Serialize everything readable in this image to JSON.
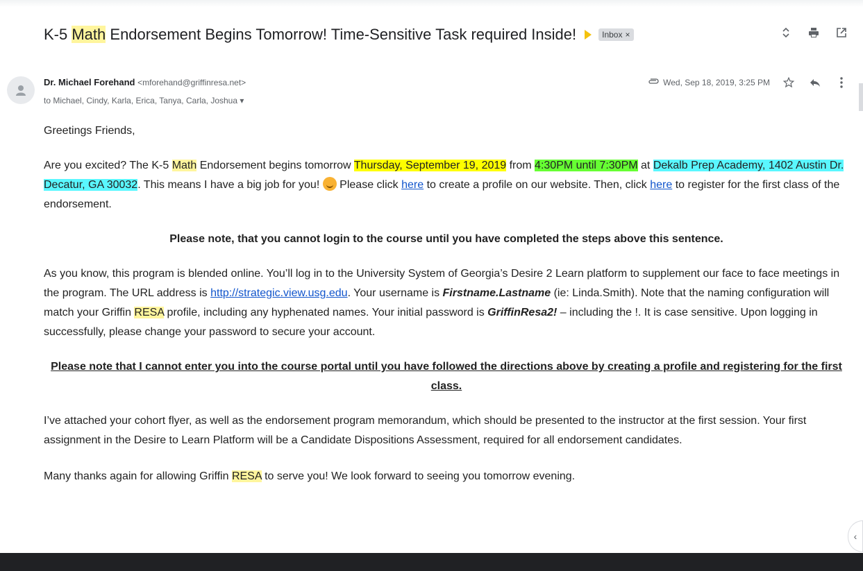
{
  "subject": {
    "pre": "K-5 ",
    "hl": "Math",
    "post": " Endorsement Begins Tomorrow! Time-Sensitive Task required Inside!",
    "label": "Inbox",
    "label_close": "×"
  },
  "sender": {
    "name": "Dr. Michael Forehand",
    "email": "<mforehand@griffinresa.net>",
    "to": "to Michael, Cindy, Karla, Erica, Tanya, Carla, Joshua",
    "date": "Wed, Sep 18, 2019, 3:25 PM"
  },
  "body": {
    "greeting": "Greetings Friends,",
    "p1_a": "Are you excited? The K-5 ",
    "p1_math": "Math",
    "p1_b": " Endorsement begins tomorrow ",
    "p1_date": "Thursday, September 19, 2019",
    "p1_c": " from ",
    "p1_time": "4:30PM until 7:30PM",
    "p1_d": " at ",
    "p1_loc": "Dekalb Prep Academy, 1402 Austin Dr. Decatur, GA 30032",
    "p1_e": ".  This means I have a big job for you! ",
    "p1_f": "  Please click ",
    "p1_link1": "here",
    "p1_g": " to create a profile on our website.  Then, click ",
    "p1_link2": "here",
    "p1_h": " to register for the first class of the endorsement.",
    "note1": "Please note, that you cannot login to the course until you have completed the steps above this sentence.",
    "p2_a": "As you know, this program is blended online. You’ll log in to the University System of Georgia’s Desire 2 Learn platform to supplement our face to face meetings in the program. The URL address is ",
    "p2_url": "http://strategic.view.usg.edu",
    "p2_b": ". Your username is ",
    "p2_user": "Firstname.Lastname",
    "p2_c": " (ie: Linda.Smith). Note that the naming configuration will match your Griffin ",
    "p2_resa": "RESA",
    "p2_d": " profile, including any hyphenated names. Your initial password is ",
    "p2_pass": "GriffinResa2!",
    "p2_e": " – including the !. It is case sensitive. Upon logging in successfully, please change your password to secure your account.",
    "note2": "Please note that I cannot enter you into the course portal until you have followed the directions above by creating a profile and registering for the first class.",
    "p3": "I’ve attached your cohort flyer, as well as the endorsement program memorandum, which should be presented to the instructor at the first session. Your first assignment in the Desire to Learn Platform will be a Candidate Dispositions Assessment, required for all endorsement candidates.",
    "p4_a": "Many thanks again for allowing Griffin ",
    "p4_resa": "RESA",
    "p4_b": " to serve you!  We look forward to seeing you tomorrow evening."
  }
}
